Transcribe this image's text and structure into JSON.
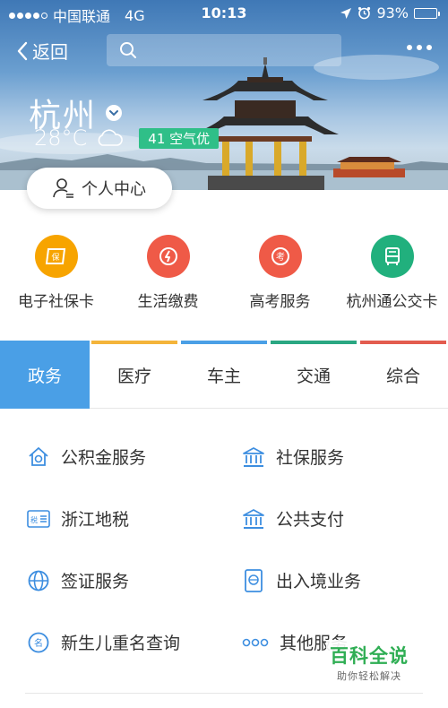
{
  "statusbar": {
    "carrier": "中国联通",
    "network": "4G",
    "time": "10:13",
    "battery": "93%",
    "battery_level": 0.93
  },
  "navbar": {
    "back_label": "返回",
    "search_placeholder": ""
  },
  "city": {
    "name": "杭州",
    "temperature": "28°C",
    "aqi": "41 空气优"
  },
  "personal_center": {
    "label": "个人中心"
  },
  "quick_services": [
    {
      "label": "电子社保卡",
      "icon": "social-security-card-icon",
      "color": "#f7a400"
    },
    {
      "label": "生活缴费",
      "icon": "utility-payment-icon",
      "color": "#ef5a47"
    },
    {
      "label": "高考服务",
      "icon": "gaokao-icon",
      "color": "#ef5a47"
    },
    {
      "label": "杭州通公交卡",
      "icon": "bus-card-icon",
      "color": "#21b07d"
    }
  ],
  "tabs": [
    {
      "label": "政务",
      "color": "#4a9fe6",
      "active": true
    },
    {
      "label": "医疗",
      "color": "#f4b43a"
    },
    {
      "label": "车主",
      "color": "#4a9fe6"
    },
    {
      "label": "交通",
      "color": "#2aa782"
    },
    {
      "label": "综合",
      "color": "#e35c4f"
    }
  ],
  "services": [
    {
      "label": "公积金服务",
      "icon": "house-fund-icon"
    },
    {
      "label": "社保服务",
      "icon": "government-building-icon"
    },
    {
      "label": "浙江地税",
      "icon": "tax-icon"
    },
    {
      "label": "公共支付",
      "icon": "government-building-icon"
    },
    {
      "label": "签证服务",
      "icon": "globe-icon"
    },
    {
      "label": "出入境业务",
      "icon": "passport-icon"
    },
    {
      "label": "新生儿重名查询",
      "icon": "name-search-icon"
    },
    {
      "label": "其他服务",
      "icon": "more-dots-icon"
    }
  ],
  "watermark": {
    "title": "百科全说",
    "subtitle": "助你轻松解决"
  },
  "colors": {
    "accent": "#4a9fe6",
    "icon_blue": "#3d8ee0"
  }
}
